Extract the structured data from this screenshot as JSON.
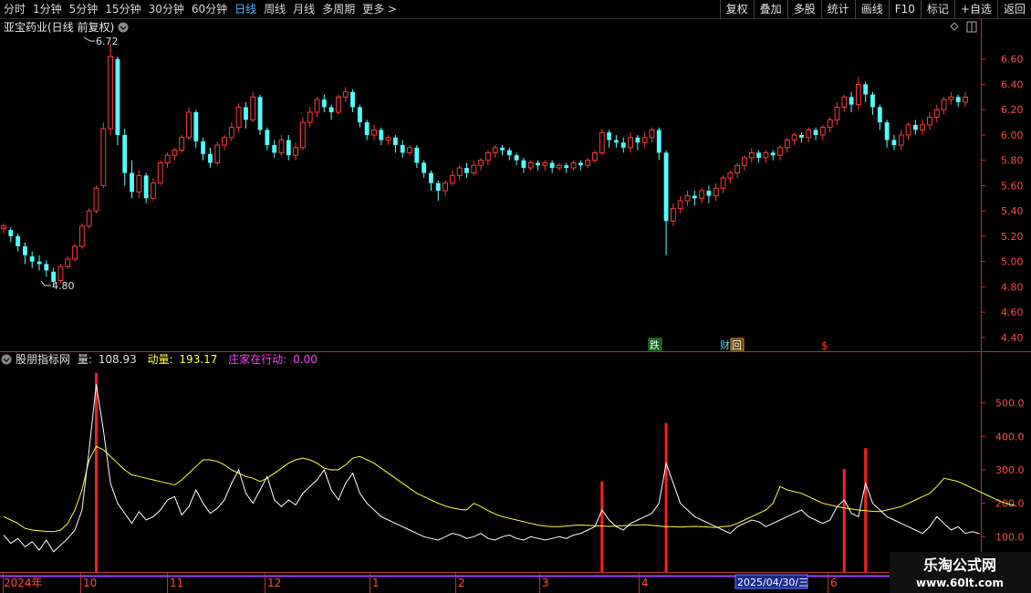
{
  "toolbar": {
    "periods": [
      "分时",
      "1分钟",
      "5分钟",
      "15分钟",
      "30分钟",
      "60分钟",
      "日线",
      "周线",
      "月线",
      "多周期",
      "更多 >"
    ],
    "active_period": "日线",
    "buttons": [
      "复权",
      "叠加",
      "多股",
      "统计",
      "画线",
      "F10",
      "标记",
      "+自选",
      "返回"
    ]
  },
  "main_panel": {
    "title": "亚宝药业(日线 前复权)",
    "y_ticks": [
      "6.60",
      "6.40",
      "6.20",
      "6.00",
      "5.80",
      "5.60",
      "5.40",
      "5.20",
      "5.00",
      "4.80",
      "4.60",
      "4.40"
    ],
    "high_label": "6.72",
    "low_label": "4.80",
    "markers": [
      "跌",
      "财",
      "回",
      "$"
    ]
  },
  "indicator_panel": {
    "name": "股朋指标网",
    "vol_label": "量:",
    "vol_value": "108.93",
    "dl_label": "动量:",
    "dl_value": "193.17",
    "zj_label": "庄家在行动:",
    "zj_value": "0.00",
    "y_ticks": [
      "500.0",
      "400.0",
      "300.0",
      "200.0",
      "100.0"
    ]
  },
  "time_axis": {
    "labels": [
      "2024年",
      "10",
      "11",
      "12",
      "1",
      "2",
      "3",
      "4",
      "2025/04/30/三",
      "6"
    ]
  },
  "watermark": {
    "title": "乐淘公式网",
    "url": "www.60lt.com"
  },
  "colors": {
    "up": "#ff3a3a",
    "down": "#54ffff",
    "vol_line": "#ffffff",
    "ma_line": "#ffff40",
    "signal": "#ff2020",
    "axis": "#c03030",
    "tab_active": "#52b4ff"
  },
  "chart_data": {
    "type": "candlestick",
    "price_ylim": [
      4.32,
      6.8
    ],
    "indicator_ylim": [
      0,
      600
    ],
    "candles": [
      [
        5.26,
        5.28,
        5.22,
        5.3
      ],
      [
        5.25,
        5.2,
        5.15,
        5.27
      ],
      [
        5.2,
        5.12,
        5.08,
        5.22
      ],
      [
        5.12,
        5.05,
        4.98,
        5.15
      ],
      [
        5.04,
        5.0,
        4.95,
        5.08
      ],
      [
        5.0,
        4.98,
        4.93,
        5.05
      ],
      [
        4.98,
        4.93,
        4.88,
        5.01
      ],
      [
        4.92,
        4.84,
        4.8,
        4.95
      ],
      [
        4.85,
        4.96,
        4.83,
        4.98
      ],
      [
        4.96,
        5.02,
        4.94,
        5.04
      ],
      [
        5.02,
        5.12,
        5.0,
        5.14
      ],
      [
        5.12,
        5.28,
        5.1,
        5.3
      ],
      [
        5.28,
        5.4,
        5.26,
        5.42
      ],
      [
        5.4,
        5.58,
        5.38,
        5.6
      ],
      [
        5.6,
        6.05,
        5.58,
        6.1
      ],
      [
        6.05,
        6.62,
        6.0,
        6.72
      ],
      [
        6.6,
        6.0,
        5.92,
        6.62
      ],
      [
        6.0,
        5.7,
        5.6,
        6.05
      ],
      [
        5.7,
        5.55,
        5.5,
        5.8
      ],
      [
        5.55,
        5.68,
        5.5,
        5.72
      ],
      [
        5.68,
        5.5,
        5.46,
        5.7
      ],
      [
        5.5,
        5.62,
        5.48,
        5.66
      ],
      [
        5.62,
        5.78,
        5.6,
        5.8
      ],
      [
        5.78,
        5.84,
        5.74,
        5.86
      ],
      [
        5.84,
        5.88,
        5.8,
        5.9
      ],
      [
        5.88,
        5.98,
        5.86,
        6.0
      ],
      [
        5.98,
        6.18,
        5.96,
        6.22
      ],
      [
        6.18,
        5.95,
        5.9,
        6.2
      ],
      [
        5.95,
        5.85,
        5.8,
        5.98
      ],
      [
        5.85,
        5.78,
        5.74,
        5.9
      ],
      [
        5.78,
        5.92,
        5.76,
        5.95
      ],
      [
        5.92,
        5.98,
        5.88,
        6.0
      ],
      [
        5.98,
        6.06,
        5.95,
        6.1
      ],
      [
        6.06,
        6.22,
        6.02,
        6.25
      ],
      [
        6.22,
        6.12,
        6.05,
        6.26
      ],
      [
        6.12,
        6.3,
        6.1,
        6.34
      ],
      [
        6.3,
        6.04,
        6.0,
        6.32
      ],
      [
        6.04,
        5.92,
        5.88,
        6.06
      ],
      [
        5.92,
        5.86,
        5.82,
        5.96
      ],
      [
        5.86,
        5.96,
        5.84,
        6.0
      ],
      [
        5.96,
        5.84,
        5.8,
        6.0
      ],
      [
        5.84,
        5.9,
        5.8,
        5.94
      ],
      [
        5.9,
        6.1,
        5.88,
        6.14
      ],
      [
        6.1,
        6.18,
        6.06,
        6.22
      ],
      [
        6.18,
        6.28,
        6.14,
        6.3
      ],
      [
        6.28,
        6.22,
        6.18,
        6.32
      ],
      [
        6.22,
        6.18,
        6.12,
        6.24
      ],
      [
        6.18,
        6.3,
        6.16,
        6.32
      ],
      [
        6.3,
        6.34,
        6.26,
        6.38
      ],
      [
        6.34,
        6.22,
        6.18,
        6.36
      ],
      [
        6.22,
        6.1,
        6.06,
        6.24
      ],
      [
        6.1,
        6.0,
        5.96,
        6.12
      ],
      [
        6.0,
        6.04,
        5.96,
        6.08
      ],
      [
        6.04,
        5.96,
        5.92,
        6.06
      ],
      [
        5.96,
        5.98,
        5.92,
        6.0
      ],
      [
        5.98,
        5.92,
        5.86,
        6.0
      ],
      [
        5.92,
        5.86,
        5.82,
        5.96
      ],
      [
        5.86,
        5.9,
        5.84,
        5.92
      ],
      [
        5.9,
        5.78,
        5.74,
        5.92
      ],
      [
        5.78,
        5.7,
        5.66,
        5.8
      ],
      [
        5.7,
        5.62,
        5.56,
        5.72
      ],
      [
        5.62,
        5.56,
        5.48,
        5.64
      ],
      [
        5.56,
        5.62,
        5.52,
        5.64
      ],
      [
        5.62,
        5.68,
        5.6,
        5.72
      ],
      [
        5.68,
        5.74,
        5.64,
        5.76
      ],
      [
        5.74,
        5.7,
        5.66,
        5.78
      ],
      [
        5.7,
        5.76,
        5.68,
        5.8
      ],
      [
        5.76,
        5.8,
        5.72,
        5.82
      ],
      [
        5.8,
        5.86,
        5.76,
        5.88
      ],
      [
        5.86,
        5.9,
        5.82,
        5.92
      ],
      [
        5.9,
        5.88,
        5.84,
        5.92
      ],
      [
        5.88,
        5.84,
        5.8,
        5.9
      ],
      [
        5.84,
        5.8,
        5.76,
        5.86
      ],
      [
        5.8,
        5.74,
        5.7,
        5.82
      ],
      [
        5.74,
        5.78,
        5.72,
        5.8
      ],
      [
        5.78,
        5.76,
        5.72,
        5.8
      ],
      [
        5.76,
        5.78,
        5.72,
        5.8
      ],
      [
        5.78,
        5.74,
        5.7,
        5.8
      ],
      [
        5.74,
        5.76,
        5.72,
        5.78
      ],
      [
        5.76,
        5.74,
        5.7,
        5.78
      ],
      [
        5.74,
        5.78,
        5.72,
        5.8
      ],
      [
        5.78,
        5.76,
        5.72,
        5.8
      ],
      [
        5.76,
        5.8,
        5.74,
        5.82
      ],
      [
        5.8,
        5.86,
        5.78,
        5.88
      ],
      [
        5.86,
        6.02,
        5.84,
        6.05
      ],
      [
        6.02,
        5.96,
        5.9,
        6.04
      ],
      [
        5.96,
        5.94,
        5.9,
        6.0
      ],
      [
        5.94,
        5.9,
        5.86,
        5.98
      ],
      [
        5.9,
        5.98,
        5.86,
        6.02
      ],
      [
        5.98,
        5.94,
        5.88,
        6.0
      ],
      [
        5.94,
        5.98,
        5.9,
        6.02
      ],
      [
        5.98,
        6.04,
        5.94,
        6.06
      ],
      [
        6.04,
        5.86,
        5.8,
        6.06
      ],
      [
        5.86,
        5.32,
        5.05,
        5.88
      ],
      [
        5.32,
        5.42,
        5.28,
        5.46
      ],
      [
        5.42,
        5.48,
        5.38,
        5.52
      ],
      [
        5.48,
        5.52,
        5.44,
        5.56
      ],
      [
        5.52,
        5.5,
        5.44,
        5.56
      ],
      [
        5.5,
        5.56,
        5.46,
        5.58
      ],
      [
        5.56,
        5.52,
        5.46,
        5.6
      ],
      [
        5.52,
        5.58,
        5.48,
        5.62
      ],
      [
        5.58,
        5.66,
        5.54,
        5.68
      ],
      [
        5.66,
        5.7,
        5.62,
        5.72
      ],
      [
        5.7,
        5.76,
        5.66,
        5.78
      ],
      [
        5.76,
        5.82,
        5.72,
        5.84
      ],
      [
        5.82,
        5.86,
        5.78,
        5.9
      ],
      [
        5.86,
        5.82,
        5.78,
        5.88
      ],
      [
        5.82,
        5.86,
        5.78,
        5.88
      ],
      [
        5.86,
        5.84,
        5.8,
        5.88
      ],
      [
        5.84,
        5.9,
        5.8,
        5.92
      ],
      [
        5.9,
        5.96,
        5.86,
        5.98
      ],
      [
        5.96,
        6.0,
        5.92,
        6.02
      ],
      [
        6.0,
        5.98,
        5.94,
        6.02
      ],
      [
        5.98,
        6.04,
        5.94,
        6.06
      ],
      [
        6.04,
        6.0,
        5.96,
        6.06
      ],
      [
        6.0,
        6.06,
        5.96,
        6.08
      ],
      [
        6.06,
        6.12,
        6.02,
        6.14
      ],
      [
        6.12,
        6.22,
        6.08,
        6.26
      ],
      [
        6.22,
        6.3,
        6.18,
        6.32
      ],
      [
        6.3,
        6.24,
        6.18,
        6.34
      ],
      [
        6.24,
        6.4,
        6.2,
        6.46
      ],
      [
        6.4,
        6.32,
        6.26,
        6.42
      ],
      [
        6.32,
        6.22,
        6.16,
        6.34
      ],
      [
        6.22,
        6.1,
        6.04,
        6.24
      ],
      [
        6.1,
        5.96,
        5.9,
        6.12
      ],
      [
        5.96,
        5.92,
        5.88,
        6.0
      ],
      [
        5.92,
        6.0,
        5.88,
        6.04
      ],
      [
        6.0,
        6.08,
        5.96,
        6.1
      ],
      [
        6.08,
        6.04,
        6.0,
        6.12
      ],
      [
        6.04,
        6.08,
        6.0,
        6.12
      ],
      [
        6.08,
        6.14,
        6.04,
        6.18
      ],
      [
        6.14,
        6.2,
        6.1,
        6.24
      ],
      [
        6.2,
        6.28,
        6.16,
        6.3
      ],
      [
        6.28,
        6.3,
        6.24,
        6.34
      ],
      [
        6.3,
        6.26,
        6.22,
        6.32
      ],
      [
        6.26,
        6.3,
        6.22,
        6.34
      ]
    ],
    "volume": [
      105,
      80,
      95,
      70,
      85,
      60,
      90,
      55,
      75,
      95,
      120,
      180,
      360,
      555,
      420,
      260,
      200,
      170,
      140,
      175,
      150,
      160,
      180,
      210,
      220,
      165,
      190,
      240,
      200,
      170,
      185,
      210,
      260,
      300,
      230,
      200,
      240,
      280,
      210,
      190,
      210,
      195,
      230,
      250,
      270,
      300,
      240,
      210,
      260,
      290,
      230,
      200,
      180,
      160,
      150,
      140,
      130,
      120,
      110,
      100,
      95,
      90,
      100,
      110,
      105,
      95,
      100,
      110,
      95,
      90,
      100,
      105,
      95,
      90,
      100,
      95,
      90,
      95,
      100,
      95,
      105,
      110,
      120,
      130,
      180,
      150,
      130,
      120,
      140,
      150,
      160,
      170,
      200,
      320,
      260,
      200,
      180,
      160,
      150,
      140,
      130,
      120,
      110,
      130,
      140,
      150,
      145,
      130,
      140,
      150,
      160,
      170,
      180,
      160,
      150,
      140,
      150,
      190,
      210,
      170,
      160,
      260,
      200,
      180,
      160,
      150,
      140,
      130,
      120,
      110,
      130,
      160,
      140,
      120,
      130,
      110,
      115,
      109
    ],
    "momentum": [
      160,
      150,
      140,
      125,
      120,
      118,
      116,
      115,
      120,
      140,
      180,
      240,
      330,
      370,
      360,
      340,
      320,
      300,
      285,
      280,
      275,
      270,
      265,
      260,
      255,
      270,
      290,
      310,
      330,
      330,
      325,
      315,
      300,
      290,
      280,
      275,
      265,
      275,
      290,
      305,
      320,
      330,
      335,
      330,
      320,
      305,
      300,
      300,
      315,
      335,
      340,
      330,
      320,
      305,
      290,
      275,
      260,
      245,
      230,
      220,
      210,
      200,
      192,
      186,
      182,
      180,
      200,
      190,
      178,
      168,
      160,
      155,
      150,
      145,
      140,
      135,
      132,
      130,
      130,
      132,
      134,
      135,
      134,
      133,
      132,
      131,
      132,
      133,
      134,
      135,
      136,
      134,
      132,
      130,
      130,
      129,
      130,
      131,
      130,
      129,
      128,
      130,
      132,
      140,
      150,
      160,
      170,
      180,
      200,
      250,
      240,
      235,
      230,
      220,
      210,
      200,
      195,
      190,
      186,
      183,
      180,
      178,
      176,
      175,
      180,
      185,
      190,
      200,
      210,
      220,
      230,
      250,
      275,
      270,
      265,
      255,
      245,
      235,
      225,
      215,
      205,
      198,
      193
    ]
  }
}
